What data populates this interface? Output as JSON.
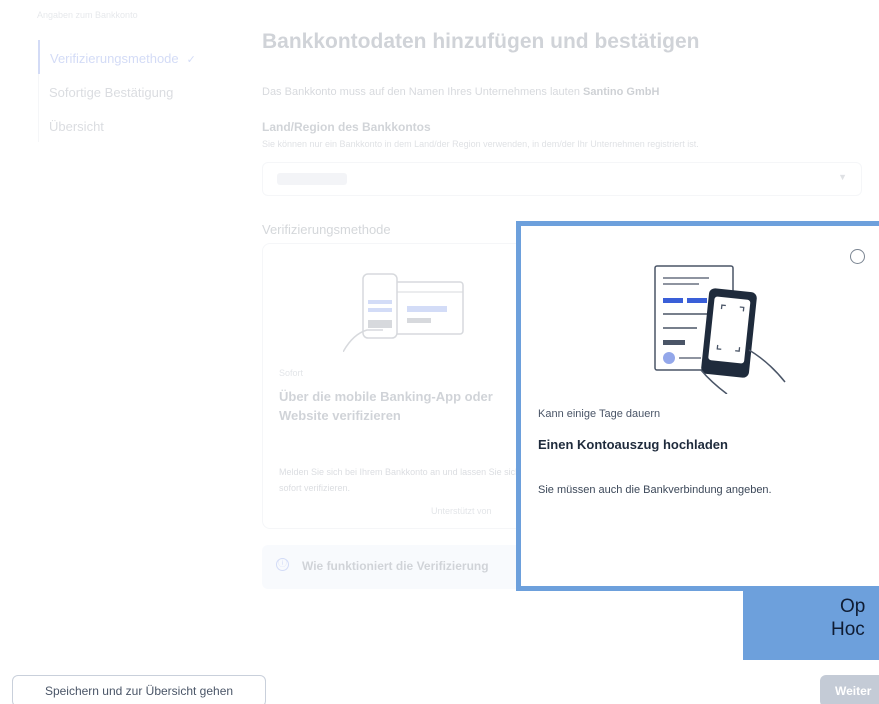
{
  "sidebar": {
    "section_title": "Angaben zum Bankkonto",
    "items": [
      {
        "label": "Verifizierungsmethode",
        "check": "✓"
      },
      {
        "label": "Sofortige Bestätigung"
      },
      {
        "label": "Übersicht"
      }
    ]
  },
  "main": {
    "title": "Bankkontodaten hinzufügen und bestätigen",
    "intro_text": "Das Bankkonto muss auf den Namen Ihres Unternehmens lauten",
    "company_name": "Santino GmbH",
    "country_label": "Land/Region des Bankkontos",
    "country_help": "Sie können nur ein Bankkonto in dem Land/der Region verwenden, in dem/der Ihr Unternehmen registriert ist.",
    "select_arrow": "▼",
    "method_label": "Verifizierungsmethode",
    "instant_card": {
      "kicker": "Sofort",
      "title": "Über die mobile Banking-App oder Website verifizieren",
      "description": "Melden Sie sich bei Ihrem Bankkonto an und lassen Sie sich sofort verifizieren.",
      "support": "Unterstützt von"
    },
    "info_box": {
      "icon": "ⓘ",
      "text": "Wie funktioniert die Verifizierung"
    }
  },
  "upload_card": {
    "kicker": "Kann einige Tage dauern",
    "title": "Einen Kontoauszug hochladen",
    "description": "Sie müssen auch die Bankverbindung angeben."
  },
  "callout": {
    "line1": "Op",
    "line2": "Hoc"
  },
  "footer": {
    "save_label": "Speichern und zur Übersicht gehen",
    "next_label": "Weiter"
  },
  "colors": {
    "accent": "#3a5fd8",
    "highlight_border": "#6da0dc"
  }
}
